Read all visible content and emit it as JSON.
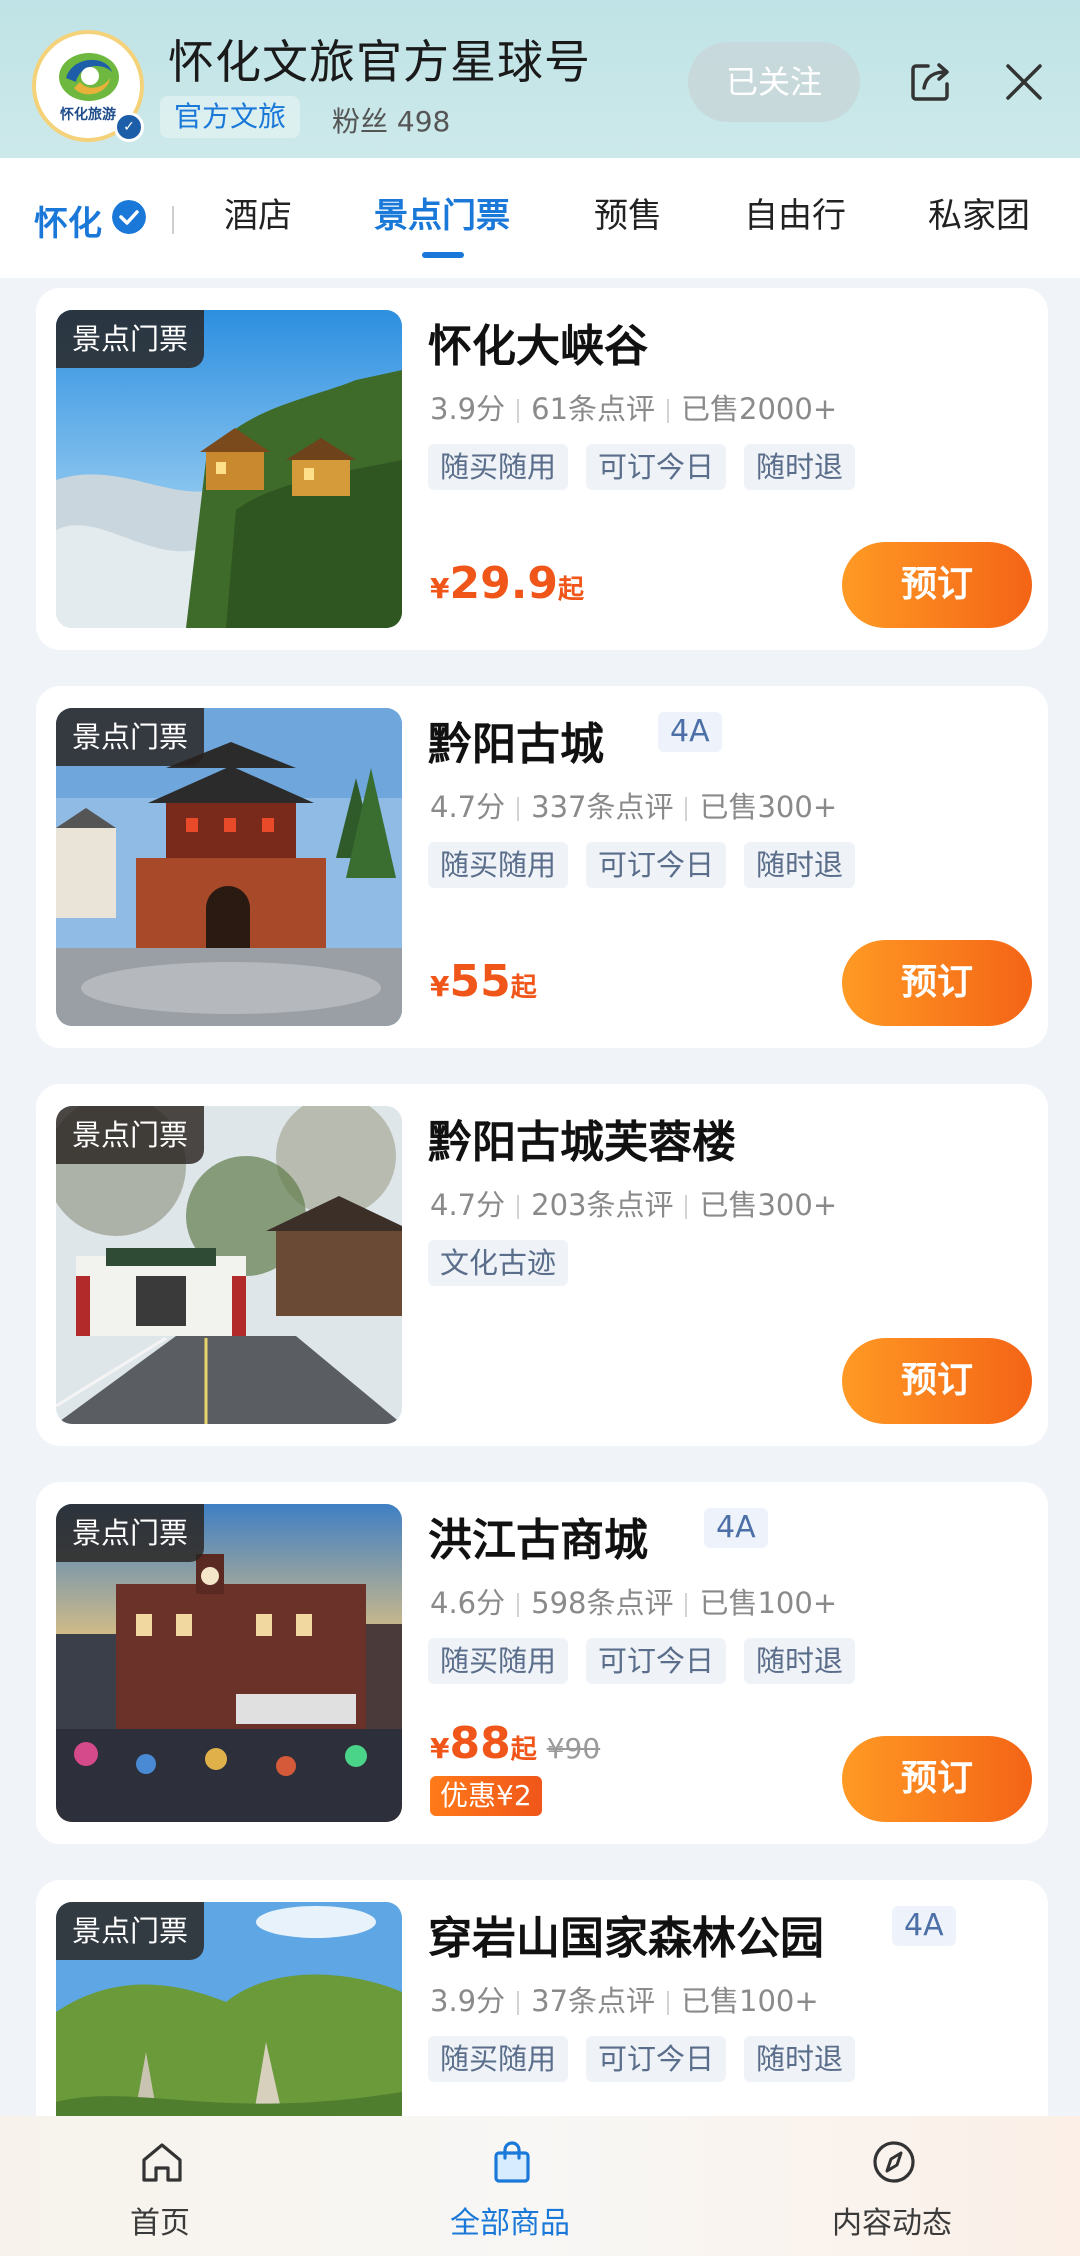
{
  "header": {
    "title": "怀化文旅官方星球号",
    "official_tag": "官方文旅",
    "fans": "粉丝 498",
    "follow_label": "已关注",
    "logo_text": "怀化旅游"
  },
  "tabs": {
    "city": "怀化",
    "items": [
      "酒店",
      "景点门票",
      "预售",
      "自由行",
      "私家团"
    ],
    "active": "景点门票"
  },
  "cards": [
    {
      "tag": "景点门票",
      "title": "怀化大峡谷",
      "level": "",
      "rating": "3.9分",
      "reviews": "61条点评",
      "sold": "已售2000+",
      "chips": [
        "随买随用",
        "可订今日",
        "随时退"
      ],
      "currency": "¥",
      "price": "29.9",
      "price_suffix": "起",
      "original_price": "",
      "discount": "",
      "book_label": "预订"
    },
    {
      "tag": "景点门票",
      "title": "黔阳古城",
      "level": "4A",
      "rating": "4.7分",
      "reviews": "337条点评",
      "sold": "已售300+",
      "chips": [
        "随买随用",
        "可订今日",
        "随时退"
      ],
      "currency": "¥",
      "price": "55",
      "price_suffix": "起",
      "original_price": "",
      "discount": "",
      "book_label": "预订"
    },
    {
      "tag": "景点门票",
      "title": "黔阳古城芙蓉楼",
      "level": "",
      "rating": "4.7分",
      "reviews": "203条点评",
      "sold": "已售300+",
      "chips": [
        "文化古迹"
      ],
      "currency": "",
      "price": "",
      "price_suffix": "",
      "original_price": "",
      "discount": "",
      "book_label": "预订"
    },
    {
      "tag": "景点门票",
      "title": "洪江古商城",
      "level": "4A",
      "rating": "4.6分",
      "reviews": "598条点评",
      "sold": "已售100+",
      "chips": [
        "随买随用",
        "可订今日",
        "随时退"
      ],
      "currency": "¥",
      "price": "88",
      "price_suffix": "起",
      "original_price": "¥90",
      "discount": "优惠¥2",
      "book_label": "预订"
    },
    {
      "tag": "景点门票",
      "title": "穿岩山国家森林公园",
      "level": "4A",
      "rating": "3.9分",
      "reviews": "37条点评",
      "sold": "已售100+",
      "chips": [
        "随买随用",
        "可订今日",
        "随时退"
      ],
      "currency": "",
      "price": "",
      "price_suffix": "",
      "original_price": "",
      "discount": "",
      "book_label": ""
    }
  ],
  "bottom_nav": [
    {
      "label": "首页",
      "icon": "home-icon"
    },
    {
      "label": "全部商品",
      "icon": "shopping-bag-icon",
      "active": true
    },
    {
      "label": "内容动态",
      "icon": "compass-icon"
    }
  ],
  "colors": {
    "accent": "#1a78d8",
    "price": "#f0561a",
    "book_button": "#f46416"
  }
}
